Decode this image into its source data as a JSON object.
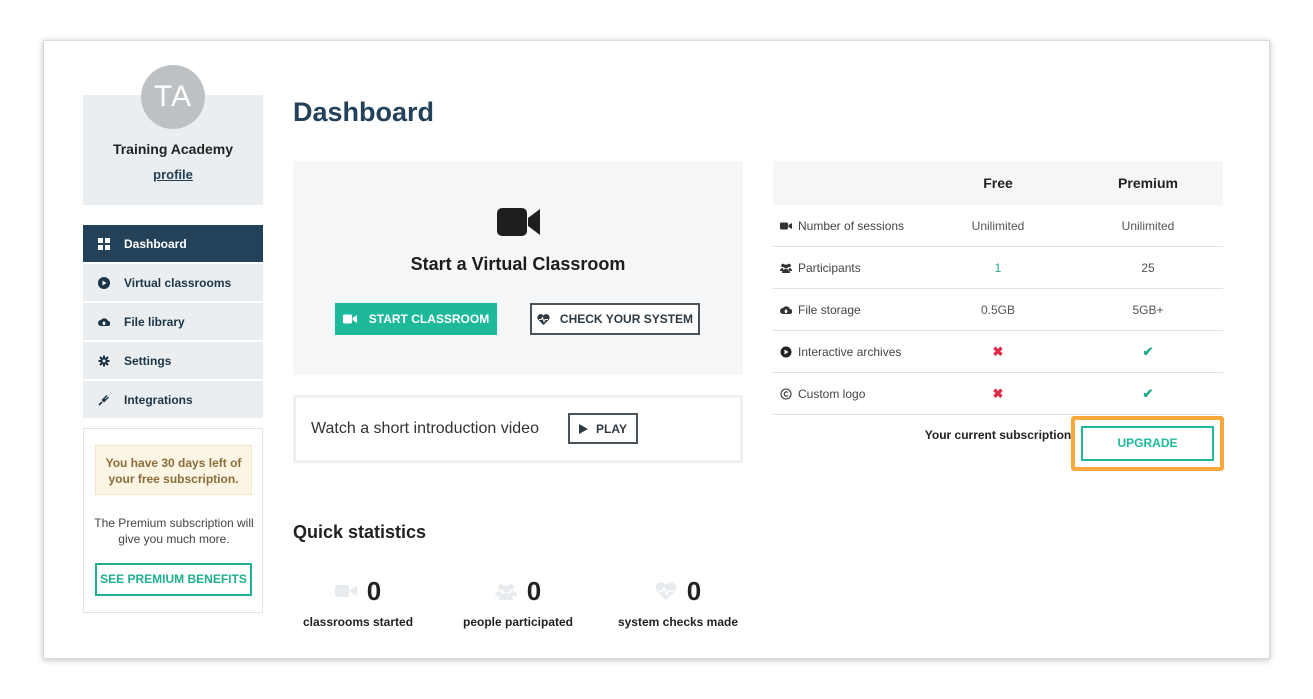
{
  "profile": {
    "initials": "TA",
    "name": "Training Academy",
    "link_label": "profile"
  },
  "nav": {
    "items": [
      {
        "label": "Dashboard",
        "icon": "dashboard-icon",
        "active": true
      },
      {
        "label": "Virtual classrooms",
        "icon": "play-circle-icon"
      },
      {
        "label": "File library",
        "icon": "cloud-upload-icon"
      },
      {
        "label": "Settings",
        "icon": "gear-icon"
      },
      {
        "label": "Integrations",
        "icon": "plug-icon"
      }
    ]
  },
  "promo": {
    "alert": "You have 30 days left of your free subscription.",
    "text": "The Premium subscription will give you much more.",
    "button": "SEE PREMIUM BENEFITS"
  },
  "page": {
    "title": "Dashboard"
  },
  "classroom": {
    "title": "Start a Virtual Classroom",
    "start_button": "START CLASSROOM",
    "check_button": "CHECK YOUR SYSTEM"
  },
  "intro": {
    "text": "Watch a short introduction video",
    "play_button": "PLAY"
  },
  "stats": {
    "title": "Quick statistics",
    "items": [
      {
        "value": "0",
        "label": "classrooms started",
        "icon": "video-camera-icon"
      },
      {
        "value": "0",
        "label": "people participated",
        "icon": "users-icon"
      },
      {
        "value": "0",
        "label": "system checks made",
        "icon": "heartbeat-icon"
      }
    ]
  },
  "comparison": {
    "headers": [
      "",
      "Free",
      "Premium"
    ],
    "rows": [
      {
        "label": "Number of sessions",
        "icon": "video-camera-icon",
        "free": "Unilimited",
        "premium": "Unilimited"
      },
      {
        "label": "Participants",
        "icon": "users-icon",
        "free": "1",
        "premium": "25"
      },
      {
        "label": "File storage",
        "icon": "cloud-upload-icon",
        "free": "0.5GB",
        "premium": "5GB+"
      },
      {
        "label": "Interactive archives",
        "icon": "play-circle-icon",
        "free": "✖",
        "premium": "✔"
      },
      {
        "label": "Custom logo",
        "icon": "copyright-icon",
        "free": "✖",
        "premium": "✔"
      }
    ],
    "current_subscription": "Your current subscription",
    "upgrade_button": "UPGRADE"
  },
  "colors": {
    "navy": "#23425a",
    "teal": "#1db99a",
    "highlight": "#f7a93c",
    "cross": "#e0294a"
  }
}
